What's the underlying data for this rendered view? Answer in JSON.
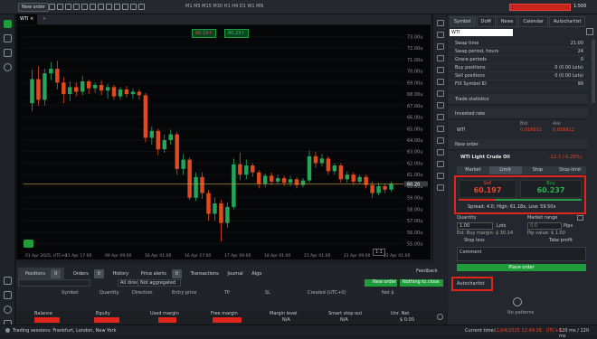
{
  "colors": {
    "accent_green": "#1f9d3a",
    "bear": "#e04a1d",
    "bull": "#21a65b",
    "price_line": "#c9a23c",
    "sell_red": "#e1251b"
  },
  "toolbar": {
    "new_order": "New order",
    "zoom": "1:500",
    "quick_order": "(none)",
    "bar_fields": "M1 M5 M15 M30 H1 H4 D1 W1 MN"
  },
  "chart": {
    "tab": "WTI",
    "sell_price": "60.19↑",
    "buy_price": "60.23↑",
    "cur_price": "60.20",
    "y_ticks": [
      "73.00u",
      "72.00u",
      "71.00u",
      "70.00u",
      "69.00u",
      "68.00u",
      "67.00u",
      "66.00u",
      "65.00u",
      "64.00u",
      "63.00u",
      "62.00u",
      "61.00u",
      "60.00u",
      "59.00u",
      "58.00u",
      "57.00u",
      "56.00u",
      "55.00u"
    ],
    "x_ticks": [
      "01 Apr 2025, UTC+0",
      "11 Apr 17:00",
      "09 Apr 09:00",
      "16 Apr 01:00",
      "16 Apr 17:00",
      "17 Apr 09:00",
      "18 Apr 01:00",
      "21 Apr 01:00",
      "21 Apr 09:00",
      "22 Apr 01:00"
    ],
    "zoom_badge": "1:1",
    "candles": [
      {
        "o": 67.2,
        "c": 69.3,
        "h": 70.1,
        "l": 66.5
      },
      {
        "o": 69.3,
        "c": 67.5,
        "h": 70.4,
        "l": 67.0
      },
      {
        "o": 67.5,
        "c": 69.8,
        "h": 70.2,
        "l": 67.0
      },
      {
        "o": 69.8,
        "c": 70.2,
        "h": 70.8,
        "l": 69.2
      },
      {
        "o": 70.2,
        "c": 69.0,
        "h": 70.9,
        "l": 68.4
      },
      {
        "o": 69.0,
        "c": 68.0,
        "h": 69.5,
        "l": 67.2
      },
      {
        "o": 68.0,
        "c": 68.6,
        "h": 69.1,
        "l": 67.4
      },
      {
        "o": 68.6,
        "c": 68.2,
        "h": 69.0,
        "l": 67.8
      },
      {
        "o": 68.2,
        "c": 69.1,
        "h": 69.6,
        "l": 67.9
      },
      {
        "o": 69.1,
        "c": 68.5,
        "h": 69.3,
        "l": 68.0
      },
      {
        "o": 68.5,
        "c": 68.8,
        "h": 69.0,
        "l": 68.1
      },
      {
        "o": 68.8,
        "c": 68.3,
        "h": 69.2,
        "l": 67.9
      },
      {
        "o": 68.3,
        "c": 68.6,
        "h": 68.9,
        "l": 67.6
      },
      {
        "o": 68.6,
        "c": 67.8,
        "h": 68.8,
        "l": 67.5
      },
      {
        "o": 67.8,
        "c": 68.4,
        "h": 68.6,
        "l": 67.5
      },
      {
        "o": 68.4,
        "c": 68.0,
        "h": 68.7,
        "l": 67.7
      },
      {
        "o": 68.0,
        "c": 68.2,
        "h": 68.5,
        "l": 67.6
      },
      {
        "o": 68.2,
        "c": 67.9,
        "h": 68.4,
        "l": 67.5
      },
      {
        "o": 67.9,
        "c": 64.2,
        "h": 68.1,
        "l": 63.8
      },
      {
        "o": 64.2,
        "c": 64.8,
        "h": 65.2,
        "l": 63.6
      },
      {
        "o": 64.8,
        "c": 63.2,
        "h": 65.0,
        "l": 62.7
      },
      {
        "o": 63.2,
        "c": 64.0,
        "h": 64.5,
        "l": 62.9
      },
      {
        "o": 64.0,
        "c": 64.5,
        "h": 64.9,
        "l": 63.6
      },
      {
        "o": 64.5,
        "c": 61.5,
        "h": 64.7,
        "l": 61.0
      },
      {
        "o": 61.5,
        "c": 62.3,
        "h": 62.8,
        "l": 61.0
      },
      {
        "o": 62.3,
        "c": 59.0,
        "h": 62.5,
        "l": 58.8
      },
      {
        "o": 59.0,
        "c": 60.8,
        "h": 61.2,
        "l": 58.7
      },
      {
        "o": 60.8,
        "c": 59.4,
        "h": 61.2,
        "l": 58.9
      },
      {
        "o": 59.4,
        "c": 57.6,
        "h": 59.7,
        "l": 57.0
      },
      {
        "o": 57.6,
        "c": 58.5,
        "h": 59.0,
        "l": 57.0
      },
      {
        "o": 58.5,
        "c": 56.8,
        "h": 58.8,
        "l": 55.2
      },
      {
        "o": 56.8,
        "c": 58.2,
        "h": 58.6,
        "l": 56.4
      },
      {
        "o": 58.2,
        "c": 61.9,
        "h": 62.4,
        "l": 58.0
      },
      {
        "o": 61.9,
        "c": 61.0,
        "h": 62.9,
        "l": 60.5
      },
      {
        "o": 61.0,
        "c": 61.8,
        "h": 62.3,
        "l": 60.6
      },
      {
        "o": 61.8,
        "c": 61.2,
        "h": 62.0,
        "l": 60.8
      },
      {
        "o": 61.2,
        "c": 60.2,
        "h": 61.4,
        "l": 59.8
      },
      {
        "o": 60.2,
        "c": 60.9,
        "h": 61.1,
        "l": 59.9
      },
      {
        "o": 60.9,
        "c": 60.4,
        "h": 61.2,
        "l": 60.1
      },
      {
        "o": 60.4,
        "c": 60.7,
        "h": 61.0,
        "l": 60.2
      },
      {
        "o": 60.7,
        "c": 60.3,
        "h": 60.9,
        "l": 60.0
      },
      {
        "o": 60.3,
        "c": 60.6,
        "h": 60.9,
        "l": 60.0
      },
      {
        "o": 60.6,
        "c": 60.1,
        "h": 60.8,
        "l": 59.8
      },
      {
        "o": 60.1,
        "c": 60.5,
        "h": 60.7,
        "l": 59.9
      },
      {
        "o": 60.5,
        "c": 62.6,
        "h": 63.1,
        "l": 60.3
      },
      {
        "o": 62.6,
        "c": 62.0,
        "h": 63.0,
        "l": 61.6
      },
      {
        "o": 62.0,
        "c": 62.4,
        "h": 62.8,
        "l": 61.7
      },
      {
        "o": 62.4,
        "c": 61.3,
        "h": 62.6,
        "l": 61.0
      },
      {
        "o": 61.3,
        "c": 61.8,
        "h": 62.0,
        "l": 61.0
      },
      {
        "o": 61.8,
        "c": 60.6,
        "h": 62.0,
        "l": 60.3
      },
      {
        "o": 60.6,
        "c": 61.0,
        "h": 61.3,
        "l": 60.3
      },
      {
        "o": 61.0,
        "c": 60.4,
        "h": 61.2,
        "l": 60.1
      },
      {
        "o": 60.4,
        "c": 60.8,
        "h": 61.0,
        "l": 60.2
      },
      {
        "o": 60.8,
        "c": 60.1,
        "h": 61.0,
        "l": 59.8
      },
      {
        "o": 60.1,
        "c": 59.4,
        "h": 60.4,
        "l": 59.0
      },
      {
        "o": 59.4,
        "c": 60.0,
        "h": 60.3,
        "l": 59.2
      },
      {
        "o": 60.0,
        "c": 59.7,
        "h": 60.2,
        "l": 59.4
      },
      {
        "o": 59.7,
        "c": 60.2,
        "h": 60.4,
        "l": 59.5
      }
    ]
  },
  "right": {
    "tabs": [
      "Symbol",
      "DoM",
      "News",
      "Calendar",
      "Autochartist"
    ],
    "symbol_select": "WTI",
    "info_rows": [
      {
        "k": "Swap time",
        "v": "21:00"
      },
      {
        "k": "Swap period, hours",
        "v": "24"
      },
      {
        "k": "Grace periods",
        "v": "0"
      },
      {
        "k": "Buy positions",
        "v": "0 (0.00 Lots)"
      },
      {
        "k": "Sell positions",
        "v": "0 (0.00 Lots)"
      },
      {
        "k": "FIX Symbol ID",
        "v": "99"
      }
    ],
    "trade_stats": "Trade statistics",
    "invested_rate": "Invested rate",
    "bid_label": "Bid",
    "ask_label": "Ask",
    "rate_sym": "WTI",
    "rate_bid": "0.016631",
    "rate_ask": "0.016612",
    "new_order": "New order",
    "instrument": "WTI Light Crude Oil",
    "change": "-12.3 (-0.20%)",
    "order_types": [
      "Market",
      "Limit",
      "Stop",
      "Stop-limit"
    ],
    "sell_label": "Sell",
    "sell_price": "60.197",
    "buy_label": "Buy",
    "buy_price": "60.237",
    "spread": "Spread: 4.0; High: 61.18x, Low: 59.50x",
    "quantity_label": "Quantity",
    "quantity": "1.00",
    "lots": "Lots",
    "market_range": "Market range",
    "range_val": "0.0",
    "pips": "Pips",
    "est_margin": "Est. Buy margin: $ 30.14",
    "pip_value": "Pip value: $ 1.00",
    "stop_loss": "Stop loss",
    "take_profit": "Take profit",
    "comment": "Comment",
    "place_order": "Place order",
    "autochartist": "Autochartist",
    "no_patterns": "No patterns"
  },
  "bottom": {
    "tabs": [
      {
        "label": "Positions",
        "count": "0"
      },
      {
        "label": "Orders",
        "count": "0"
      },
      {
        "label": "History",
        "count": ""
      },
      {
        "label": "Price alerts",
        "count": "0"
      },
      {
        "label": "Transactions",
        "count": ""
      },
      {
        "label": "Journal",
        "count": ""
      },
      {
        "label": "Algo",
        "count": ""
      }
    ],
    "feedback": "Feedback",
    "direction": "All directions (d",
    "aggregation": "Not aggregated",
    "new_order_btn": "New order",
    "nothing_close": "Nothing to close",
    "cols": [
      "Symbol",
      "Quantity",
      "Direction",
      "Entry price",
      "TP",
      "SL",
      "Created (UTC+0)",
      "Net $"
    ],
    "balance": "Balance",
    "equity": "Equity",
    "used_margin": "Used margin",
    "free_margin": "Free margin",
    "margin_level": "Margin level",
    "smart_stop": "Smart stop out",
    "unr_net": "Unr. Net",
    "margin_level_val": "N/A",
    "smart_stop_val": "N/A",
    "unr_net_val": "$ 0.00"
  },
  "status": {
    "sessions": "Trading sessions: Frankfurt, London, New York",
    "server_label": "Current time:",
    "server_time": "11/04/2025 12:49:28 · UTC+0",
    "latency": "120 ms / 120 ms"
  }
}
